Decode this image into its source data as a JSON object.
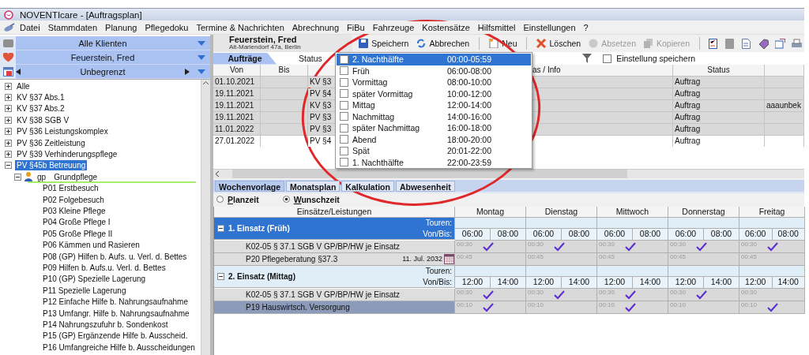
{
  "window": {
    "title": "NOVENTIcare - [Auftragsplan]"
  },
  "menu": [
    "Datei",
    "Stammdaten",
    "Planung",
    "Pflegedoku",
    "Termine & Nachrichten",
    "Abrechnung",
    "FiBu",
    "Fahrzeuge",
    "Kostensätze",
    "Hilfsmittel",
    "Einstellungen",
    "?"
  ],
  "client_panel": {
    "selectors": [
      {
        "kind": "group",
        "label": "Alle Klienten"
      },
      {
        "kind": "client",
        "label": "Feuerstein, Fred"
      },
      {
        "kind": "period",
        "label": "Unbegrenzt"
      }
    ],
    "tree": [
      {
        "label": "Alle",
        "expanded": false,
        "selected": false
      },
      {
        "label": "KV §37 Abs.1",
        "expanded": false,
        "selected": false
      },
      {
        "label": "KV §37 Abs.2",
        "expanded": false,
        "selected": false
      },
      {
        "label": "KV §38 SGB V",
        "expanded": false,
        "selected": false
      },
      {
        "label": "PV §36 Leistungskomplex",
        "expanded": false,
        "selected": false
      },
      {
        "label": "PV §36 Zeitleistung",
        "expanded": false,
        "selected": false
      },
      {
        "label": "PV §39 Verhinderungspflege",
        "expanded": false,
        "selected": false
      },
      {
        "label": "PV §45b Betreuung",
        "expanded": true,
        "selected": true,
        "children": [
          {
            "code": "gp",
            "label": "Grundpflege",
            "expanded": true,
            "selected": false,
            "children": [
              {
                "label": "P01 Erstbesuch",
                "selected": false
              },
              {
                "label": "P02 Folgebesuch",
                "selected": false
              },
              {
                "label": "P03 Kleine Pflege",
                "selected": false
              },
              {
                "label": "P04 Große Pflege I",
                "selected": false
              },
              {
                "label": "P05 Große Pflege II",
                "selected": false
              },
              {
                "label": "P06 Kämmen und Rasieren",
                "selected": false
              },
              {
                "label": "P08 (GP) Hilfen b. Aufs. u. Verl. d. Bettes",
                "selected": false
              },
              {
                "label": "P09 Hilfen b. Aufs.u. Verl. d. Bettes",
                "selected": false
              },
              {
                "label": "P10 (GP) Spezielle Lagerung",
                "selected": false
              },
              {
                "label": "P11 Spezielle Lagerung",
                "selected": false
              },
              {
                "label": "P12 Einfache Hilfe b. Nahrungsaufnahme",
                "selected": false
              },
              {
                "label": "P13 Umfangr. Hilfe b. Nahrungsaufnahme",
                "selected": false
              },
              {
                "label": "P14 Nahrungszufuhr b. Sondenkost",
                "selected": false
              },
              {
                "label": "P15 (GP) Ergänzende Hilfe b. Ausscheid.",
                "selected": false
              },
              {
                "label": "P16 Umfangreiche Hilfe b. Ausscheidungen",
                "selected": false
              }
            ]
          }
        ]
      }
    ]
  },
  "client": {
    "name": "Feuerstein, Fred",
    "address": "Alt-Mariendorf 47a, Berlin"
  },
  "toolbar": [
    {
      "label": "Speichern",
      "disabled": false
    },
    {
      "label": "Abbrechen",
      "disabled": false
    },
    {
      "label": "Neu",
      "disabled": false
    },
    {
      "label": "Löschen",
      "disabled": false
    },
    {
      "label": "Absetzen",
      "disabled": true
    },
    {
      "label": "Kopieren",
      "disabled": true
    }
  ],
  "tabs": [
    {
      "label": "Aufträge",
      "selected": true
    }
  ],
  "status_label": "Status",
  "save_setting": {
    "label": "Einstellung speichern",
    "checked": false
  },
  "orders_table": {
    "headers": {
      "von": "Von",
      "bis": "Bis",
      "info": "as / Info",
      "status": "Status"
    },
    "rows": [
      {
        "von": "01.10.2021",
        "column_3": "KV §3",
        "status": "Auftrag",
        "selected": false
      },
      {
        "von": "19.11.2021",
        "column_3": "PV §4",
        "status": "Auftrag",
        "selected": false
      },
      {
        "von": "19.11.2021",
        "column_3": "KV §3",
        "status": "Auftrag",
        "column_6": "aaaunbek",
        "selected": false
      },
      {
        "von": "19.11.2021",
        "column_3": "PV §3",
        "status": "Auftrag",
        "selected": false
      },
      {
        "von": "11.01.2022",
        "column_3": "PV §3",
        "status": "Auftrag",
        "selected": false
      },
      {
        "von": "27.01.2022",
        "column_3": "PV §4",
        "status": "Auftrag",
        "selected": true
      }
    ]
  },
  "time_slots": [
    {
      "label": "2. Nachthälfte",
      "time": "00:00-05:59",
      "checked": false,
      "selected": true
    },
    {
      "label": "Früh",
      "time": "06:00-08:00",
      "checked": false,
      "selected": false
    },
    {
      "label": "Vormittag",
      "time": "08:00-10:00",
      "checked": false,
      "selected": false
    },
    {
      "label": "später Vormittag",
      "time": "10:00-12:00",
      "checked": false,
      "selected": false
    },
    {
      "label": "Mittag",
      "time": "12:00-14:00",
      "checked": false,
      "selected": false
    },
    {
      "label": "Nachmittag",
      "time": "14:00-16:00",
      "checked": false,
      "selected": false
    },
    {
      "label": "später Nachmittag",
      "time": "16:00-18:00",
      "checked": false,
      "selected": false
    },
    {
      "label": "Abend",
      "time": "18:00-20:00",
      "checked": false,
      "selected": false
    },
    {
      "label": "Spät",
      "time": "20:01-22:00",
      "checked": false,
      "selected": false
    },
    {
      "label": "1. Nachthälfte",
      "time": "22:00-23:59",
      "checked": false,
      "selected": false
    }
  ],
  "lower_tabs": [
    {
      "label": "Wochenvorlage",
      "selected": true
    },
    {
      "label": "Monatsplan",
      "selected": false
    },
    {
      "label": "Kalkulation",
      "selected": false
    },
    {
      "label": "Abwesenheit",
      "selected": false
    }
  ],
  "time_mode": [
    {
      "label": "Planzeit",
      "selected": false
    },
    {
      "label": "Wunschzeit",
      "selected": true
    }
  ],
  "week_plan": {
    "header": "Einsätze/Leistungen",
    "days": [
      "Montag",
      "Dienstag",
      "Mittwoch",
      "Donnerstag",
      "Freitag"
    ],
    "groups": [
      {
        "title": "1. Einsatz (Früh)",
        "expanded": true,
        "selected": true,
        "touren_label": "Touren:",
        "times_label": "Von/Bis:",
        "times": [
          {
            "von": "06:00",
            "bis": "08:00"
          },
          {
            "von": "06:00",
            "bis": "08:00"
          },
          {
            "von": "06:00",
            "bis": "08:00"
          },
          {
            "von": "06:00",
            "bis": "08:00"
          },
          {
            "von": "06:00",
            "bis": "08:00"
          }
        ],
        "rows": [
          {
            "label": "K02-05 § 37.1 SGB V GP/BP/HW je Einsatz",
            "selected": false,
            "cells": [
              {
                "duration": "00:30",
                "checked": true
              },
              {
                "duration": "00:30",
                "checked": true
              },
              {
                "duration": "00:30",
                "checked": true
              },
              {
                "duration": "00:30",
                "checked": true
              },
              {
                "duration": "00:30",
                "checked": true
              }
            ]
          },
          {
            "label": "P20 Pflegeberatung §37.3",
            "date": "11. Jul. 2032",
            "selected": false,
            "cells": [
              {
                "duration": "00:45",
                "checked": false
              },
              {
                "duration": "00:45",
                "checked": false
              },
              {
                "duration": "00:45",
                "checked": false
              },
              {
                "duration": "00:45",
                "checked": false
              },
              {
                "duration": "00:45",
                "checked": false
              }
            ]
          }
        ]
      },
      {
        "title": "2. Einsatz (Mittag)",
        "expanded": true,
        "selected": false,
        "touren_label": "Touren:",
        "times_label": "Von/Bis:",
        "times": [
          {
            "von": "12:00",
            "bis": "14:00"
          },
          {
            "von": "12:00",
            "bis": "14:00"
          },
          {
            "von": "12:00",
            "bis": "14:00"
          },
          {
            "von": "12:00",
            "bis": "14:00"
          },
          {
            "von": "12:00",
            "bis": "14:00"
          }
        ],
        "rows": [
          {
            "label": "K02-05 § 37.1 SGB V GP/BP/HW je Einsatz",
            "selected": false,
            "cells": [
              {
                "duration": "00:30",
                "checked": true
              },
              {
                "duration": "00:30",
                "checked": true
              },
              {
                "duration": "00:30",
                "checked": true
              },
              {
                "duration": "00:30",
                "checked": true
              },
              {
                "duration": "00:30",
                "checked": false
              }
            ]
          },
          {
            "label": "P19 Hauswirtsch. Versorgung",
            "selected": true,
            "cells": [
              {
                "duration": "00:10",
                "checked": true
              },
              {
                "duration": "00:10",
                "checked": false
              },
              {
                "duration": "00:10",
                "checked": true
              },
              {
                "duration": "00:10",
                "checked": false
              },
              {
                "duration": "00:10",
                "checked": true
              }
            ]
          }
        ]
      }
    ]
  }
}
